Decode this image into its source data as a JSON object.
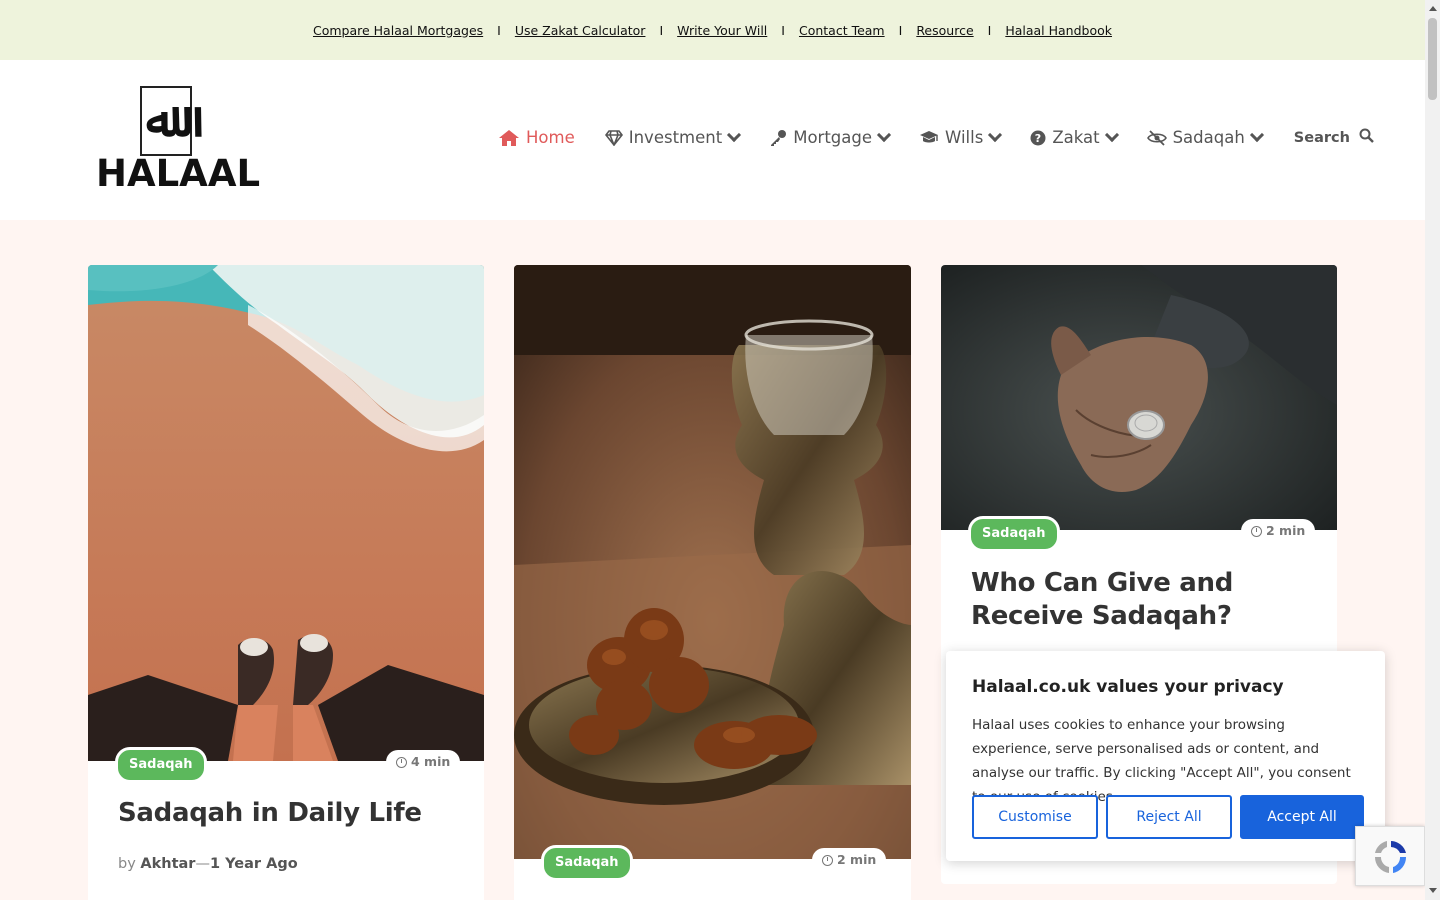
{
  "topbar": {
    "links": [
      "Compare Halaal Mortgages",
      "Use Zakat Calculator",
      "Write Your Will",
      "Contact Team",
      "Resource",
      "Halaal Handbook"
    ],
    "separator": "I"
  },
  "logo": {
    "glyph": "ﷲ",
    "wordmark": "HALAAL"
  },
  "nav": {
    "items": [
      {
        "label": "Home",
        "icon": "home-icon"
      },
      {
        "label": "Investment",
        "icon": "diamond-icon"
      },
      {
        "label": "Mortgage",
        "icon": "key-icon"
      },
      {
        "label": "Wills",
        "icon": "graduation-cap-icon"
      },
      {
        "label": "Zakat",
        "icon": "question-circle-icon"
      },
      {
        "label": "Sadaqah",
        "icon": "eye-slash-icon"
      }
    ],
    "search_label": "Search"
  },
  "colors": {
    "accent": "#e05a5a",
    "badge": "#5cb85c",
    "cookie_blue": "#1863dc",
    "topbar_bg": "#eef3dc",
    "page_bg": "#fff5f2"
  },
  "cards": [
    {
      "category": "Sadaqah",
      "read_time": "4 min",
      "title": "Sadaqah in Daily Life",
      "by": "by",
      "author": "Akhtar",
      "dash": "—",
      "date": "1 Year Ago",
      "image": "feet-on-beach-photo"
    },
    {
      "category": "Sadaqah",
      "read_time": "2 min",
      "title": "",
      "image": "dates-and-tea-photo"
    },
    {
      "category": "Sadaqah",
      "read_time": "2 min",
      "title": "Who Can Give and Receive Sadaqah?",
      "image": "hand-holding-coin-photo"
    }
  ],
  "cookie": {
    "title": "Halaal.co.uk values your privacy",
    "body": "Halaal uses cookies to enhance your browsing experience, serve personalised ads or content, and analyse our traffic. By clicking \"Accept All\", you consent to our use of cookies.",
    "customise": "Customise",
    "reject": "Reject All",
    "accept": "Accept All"
  }
}
